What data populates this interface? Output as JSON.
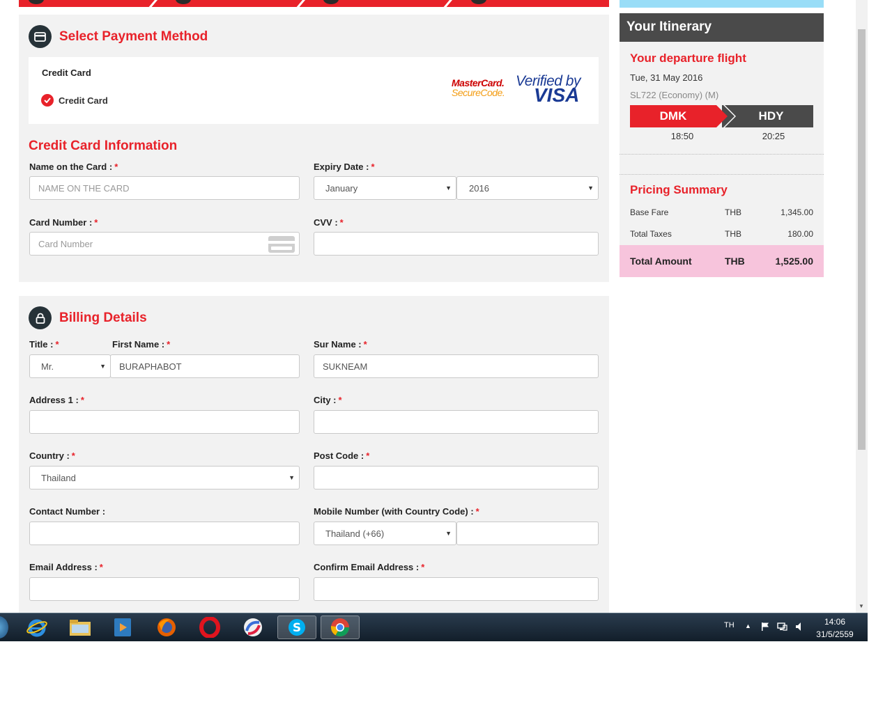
{
  "payment": {
    "title": "Select Payment Method",
    "method_heading": "Credit Card",
    "method_option": "Credit Card",
    "logo_mastercard_line1": "MasterCard.",
    "logo_mastercard_line2": "SecureCode.",
    "logo_visa_line1": "Verified by",
    "logo_visa_line2": "VISA"
  },
  "card_info": {
    "title": "Credit Card Information",
    "name_label": "Name on the Card :",
    "name_placeholder": "NAME ON THE CARD",
    "expiry_label": "Expiry Date :",
    "expiry_month": "January",
    "expiry_year": "2016",
    "number_label": "Card Number :",
    "number_placeholder": "Card Number",
    "cvv_label": "CVV :",
    "cvv_value": "",
    "required_mark": "*"
  },
  "billing": {
    "title": "Billing Details",
    "title_label": "Title :",
    "title_value": "Mr.",
    "first_name_label": "First Name :",
    "first_name_value": "BURAPHABOT",
    "surname_label": "Sur Name :",
    "surname_value": "SUKNEAM",
    "address_label": "Address 1 :",
    "city_label": "City :",
    "country_label": "Country :",
    "country_value": "Thailand",
    "postcode_label": "Post Code :",
    "contact_label": "Contact Number :",
    "mobile_label": "Mobile Number (with Country Code) :",
    "mobile_code_value": "Thailand (+66)",
    "email_label": "Email Address :",
    "confirm_email_label": "Confirm Email Address :"
  },
  "itinerary": {
    "header": "Your Itinerary",
    "departure_title": "Your departure flight",
    "date": "Tue, 31 May 2016",
    "flight": "SL722 (Economy) (M)",
    "origin": "DMK",
    "destination": "HDY",
    "depart_time": "18:50",
    "arrive_time": "20:25",
    "pricing_title": "Pricing Summary",
    "base_fare_label": "Base Fare",
    "base_fare_currency": "THB",
    "base_fare_amount": "1,345.00",
    "taxes_label": "Total Taxes",
    "taxes_currency": "THB",
    "taxes_amount": "180.00",
    "total_label": "Total Amount",
    "total_currency": "THB",
    "total_amount": "1,525.00"
  },
  "taskbar": {
    "language": "TH",
    "time": "14:06",
    "date": "31/5/2559"
  },
  "colors": {
    "accent_red": "#e8222a",
    "total_pink": "#f7c4dc",
    "header_dark": "#4a4a4a"
  }
}
